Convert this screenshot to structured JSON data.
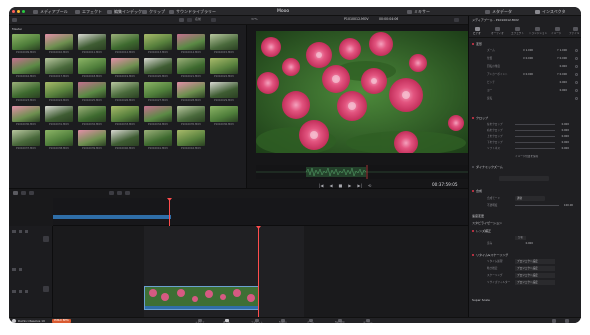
{
  "app": {
    "title": "Mooo",
    "brand": "DaVinci Resolve 19",
    "brand_badge": "PUBLIC BETA"
  },
  "toolbar": {
    "media_pool": "メディアプール",
    "effects": "エフェクト",
    "clip": "クリップ",
    "edit_index": "編集インデックス",
    "sound_library": "サウンドライブラリー",
    "mixer": "ミキサー",
    "metadata": "メタデータ",
    "inspector": "インスペクタ"
  },
  "media_pool": {
    "bin_label": "Master",
    "sort_label": "名前",
    "clips": [
      "P1010009.MOV",
      "P1010010.MOV",
      "P1010011.MOV",
      "P1010012.MOV",
      "P1010013.MOV",
      "P1010014.MOV",
      "P1010015.MOV",
      "P1010016.MOV",
      "P1010017.MOV",
      "P1010018.MOV",
      "P1010019.MOV",
      "P1010020.MOV",
      "P1010021.MOV",
      "P1010022.MOV",
      "P1010023.MOV",
      "P1010024.MOV",
      "P1010025.MOV",
      "P1010026.MOV",
      "P1010027.MOV",
      "P1010028.MOV",
      "P1010029.MOV",
      "P1010030.MOV",
      "P1010031.MOV",
      "P1010032.MOV",
      "P1010033.MOV",
      "P1010034.MOV",
      "P1010035.MOV",
      "P1010036.MOV",
      "P1010037.MOV",
      "P1010038.MOV",
      "P1010039.MOV",
      "P1010040.MOV",
      "P1010041.MOV",
      "P1010042.MOV"
    ]
  },
  "viewer": {
    "zoom": "37%",
    "clip_name": "P1010012.MOV",
    "timecode_top": "00:00:04:06",
    "timecode": "00:37:59:05"
  },
  "inspector": {
    "clip_name": "メディアプール - P1010012.MOV",
    "tabs": [
      "ビデオ",
      "オーディオ",
      "エフェクト",
      "トランジション",
      "イメージ",
      "ファイル"
    ],
    "transform": {
      "title": "変形",
      "rows": [
        {
          "label": "ズーム",
          "x": "X 1.000",
          "y": "Y 1.000"
        },
        {
          "label": "位置",
          "x": "X 0.000",
          "y": "Y 0.000"
        },
        {
          "label": "回転の角度",
          "x": "",
          "y": "0.000"
        },
        {
          "label": "アンカーポイント",
          "x": "X 0.000",
          "y": "Y 0.000"
        },
        {
          "label": "ピッチ",
          "x": "",
          "y": "0.000"
        },
        {
          "label": "ヨー",
          "x": "",
          "y": "0.000"
        },
        {
          "label": "反転",
          "x": "",
          "y": ""
        }
      ]
    },
    "crop": {
      "title": "クロップ",
      "rows": [
        {
          "label": "左をクロップ",
          "value": "0.000"
        },
        {
          "label": "右をクロップ",
          "value": "0.000"
        },
        {
          "label": "上をクロップ",
          "value": "0.000"
        },
        {
          "label": "下をクロップ",
          "value": "0.000"
        },
        {
          "label": "ソフトネス",
          "value": "0.000"
        }
      ],
      "retain": "イメージ位置を保持"
    },
    "dynamic_zoom": "ダイナミックズーム",
    "composite": {
      "title": "合成",
      "mode_label": "合成モード",
      "mode_value": "通常",
      "opacity_label": "不透明度",
      "opacity_value": "100.00"
    },
    "speed_change": "速度変更",
    "stabilization": "スタビライゼーション",
    "lens_correction": {
      "title": "レンズ補正",
      "sub": "分析",
      "label": "歪み",
      "value": "0.000"
    },
    "retime": {
      "title": "リタイム&スケーリング",
      "rows": [
        {
          "label": "リタイム処理",
          "value": "プロジェクト設定"
        },
        {
          "label": "動き推定",
          "value": "プロジェクト設定"
        },
        {
          "label": "スケーリング",
          "value": "プロジェクト設定"
        },
        {
          "label": "リサイズフィルター",
          "value": "プロジェクト設定"
        }
      ]
    },
    "super_scale": "Super Scale"
  },
  "pages": [
    "メディア",
    "カット",
    "エディット",
    "Fusion",
    "カラー",
    "Fairlight",
    "デリバー"
  ],
  "colors": {
    "accent": "#e0364a",
    "clip_blue": "#2f6ea8",
    "playhead": "#ff4d4d"
  }
}
